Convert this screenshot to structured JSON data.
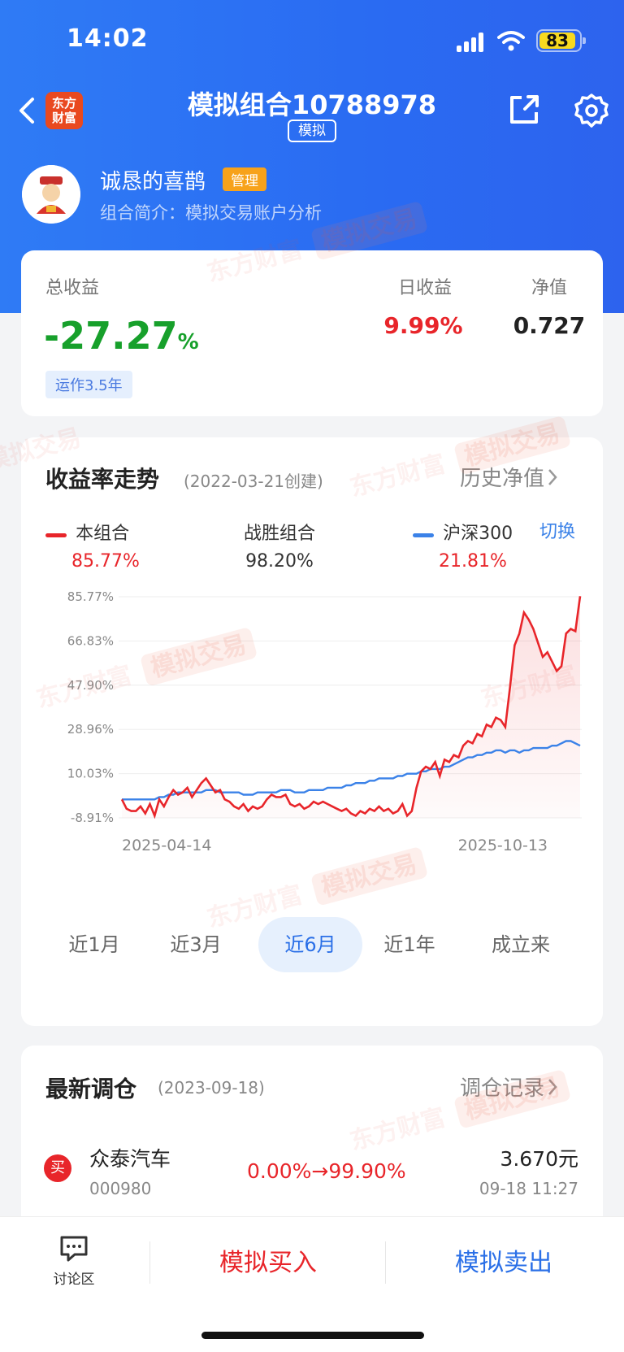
{
  "status": {
    "time": "14:02",
    "battery": "83"
  },
  "header": {
    "logo_text": "东方\n财富",
    "title": "模拟组合10788978",
    "badge": "模拟"
  },
  "user": {
    "name": "诚恳的喜鹊",
    "role_badge": "管理",
    "intro": "组合简介：模拟交易账户分析"
  },
  "summary": {
    "total_label": "总收益",
    "total_value": "-27.27",
    "total_unit": "%",
    "runtime": "运作3.5年",
    "daily_label": "日收益",
    "daily_value": "9.99%",
    "nav_label": "净值",
    "nav_value": "0.727"
  },
  "trend": {
    "title": "收益率走势",
    "created": "(2022-03-21创建)",
    "history_link": "历史净值",
    "legend": [
      {
        "name": "本组合",
        "value": "85.77%",
        "color": "#e8252a"
      },
      {
        "name": "战胜组合",
        "value": "98.20%"
      },
      {
        "name": "沪深300",
        "value": "21.81%",
        "color": "#3b82e8"
      }
    ],
    "switch_label": "切换",
    "tabs": [
      "近1月",
      "近3月",
      "近6月",
      "近1年",
      "成立来"
    ],
    "active_tab": 2
  },
  "chart_data": {
    "type": "line",
    "y_ticks": [
      "85.77%",
      "66.83%",
      "47.90%",
      "28.96%",
      "10.03%",
      "-8.91%"
    ],
    "ylim": [
      -8.91,
      85.77
    ],
    "x_start": "2025-04-14",
    "x_end": "2025-10-13",
    "series": [
      {
        "name": "本组合",
        "color": "#e8252a",
        "values": [
          -1,
          -5,
          -6,
          -6,
          -4,
          -7,
          -3,
          -8,
          -1,
          -4,
          0,
          3,
          1,
          2,
          4,
          0,
          3,
          6,
          8,
          5,
          2,
          3,
          -1,
          -2,
          -4,
          -5,
          -3,
          -6,
          -4,
          -5,
          -4,
          -1,
          1,
          0,
          0,
          1,
          -3,
          -4,
          -3,
          -5,
          -4,
          -2,
          -3,
          -2,
          -3,
          -4,
          -5,
          -6,
          -5,
          -7,
          -8,
          -6,
          -7,
          -5,
          -6,
          -4,
          -6,
          -5,
          -7,
          -6,
          -3,
          -8,
          -6,
          4,
          11,
          13,
          12,
          15,
          9,
          16,
          15,
          18,
          17,
          22,
          24,
          23,
          27,
          26,
          31,
          30,
          34,
          33,
          30,
          47,
          65,
          70,
          79,
          76,
          72,
          66,
          60,
          62,
          58,
          54,
          56,
          70,
          72,
          71,
          86
        ]
      },
      {
        "name": "沪深300",
        "color": "#3b82e8",
        "values": [
          -1,
          -1,
          -1,
          -1,
          -1,
          -1,
          -1,
          -1,
          0,
          0,
          1,
          1,
          2,
          2,
          2,
          2,
          2,
          2,
          3,
          3,
          3,
          2,
          2,
          2,
          2,
          2,
          1,
          1,
          1,
          2,
          2,
          2,
          2,
          2,
          3,
          3,
          3,
          2,
          2,
          2,
          3,
          3,
          3,
          3,
          4,
          4,
          4,
          4,
          5,
          5,
          6,
          6,
          6,
          7,
          7,
          8,
          8,
          8,
          8,
          9,
          9,
          10,
          10,
          10,
          11,
          11,
          12,
          12,
          12,
          13,
          13,
          14,
          15,
          16,
          17,
          17,
          18,
          18,
          19,
          19,
          20,
          20,
          19,
          20,
          20,
          19,
          20,
          20,
          21,
          21,
          21,
          21,
          22,
          22,
          23,
          24,
          24,
          23,
          22
        ]
      }
    ],
    "grid": true
  },
  "rebalance": {
    "title": "最新调仓",
    "date": "(2023-09-18)",
    "link": "调仓记录",
    "items": [
      {
        "action": "买",
        "name": "众泰汽车",
        "code": "000980",
        "change": "0.00%→99.90%",
        "price": "3.670元",
        "time": "09-18 11:27"
      }
    ]
  },
  "bottom": {
    "discuss": "讨论区",
    "buy": "模拟买入",
    "sell": "模拟卖出"
  },
  "watermark": {
    "brand": "东方财富",
    "tag": "模拟交易"
  }
}
